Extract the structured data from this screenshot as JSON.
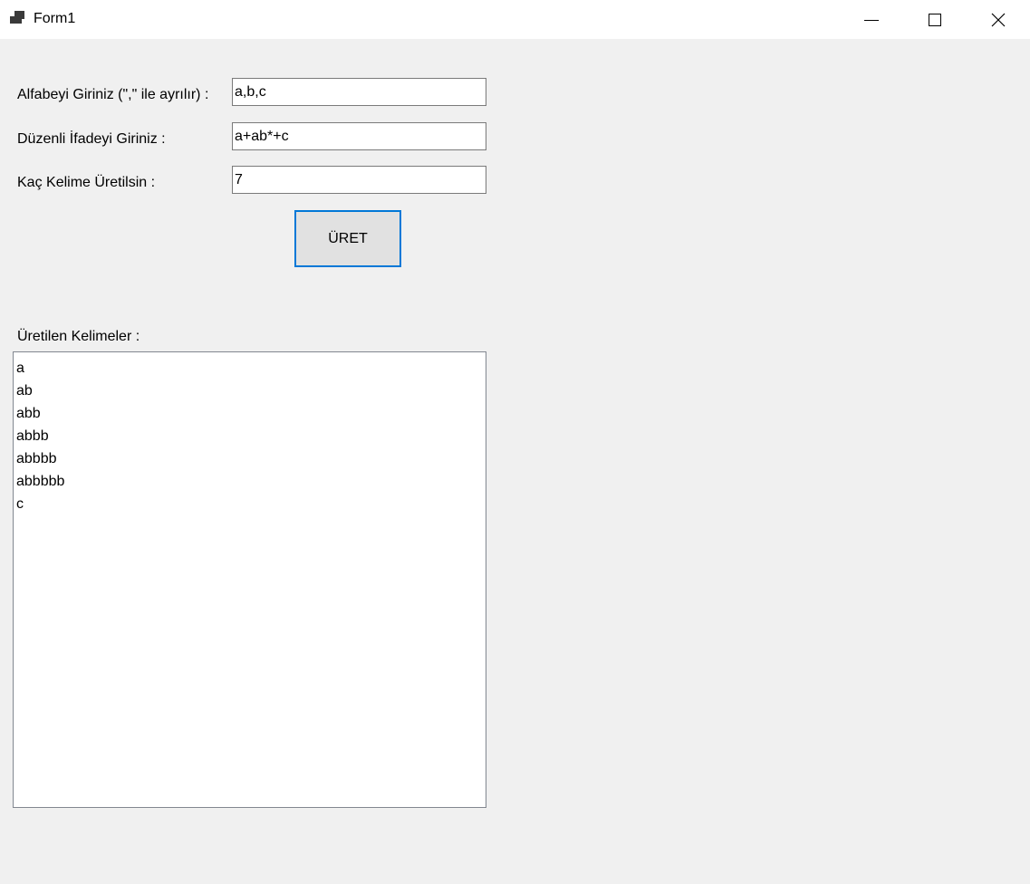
{
  "window": {
    "title": "Form1",
    "icon": "form-app-icon",
    "controls": [
      "minimize-icon",
      "maximize-icon",
      "close-icon"
    ]
  },
  "form": {
    "alphabet_label": "Alfabeyi Giriniz (\",\" ile ayrılır) :",
    "alphabet_value": "a,b,c",
    "regex_label": "Düzenli İfadeyi Giriniz :",
    "regex_value": "a+ab*+c",
    "count_label": "Kaç Kelime Üretilsin :",
    "count_value": "7",
    "generate_button": "ÜRET"
  },
  "results": {
    "label": "Üretilen Kelimeler :",
    "items": [
      "a",
      "ab",
      "abb",
      "abbb",
      "abbbb",
      "abbbbb",
      "c"
    ]
  },
  "colors": {
    "background": "#f0f0f0",
    "titlebar": "#ffffff",
    "button_focus_border": "#0078d7"
  }
}
